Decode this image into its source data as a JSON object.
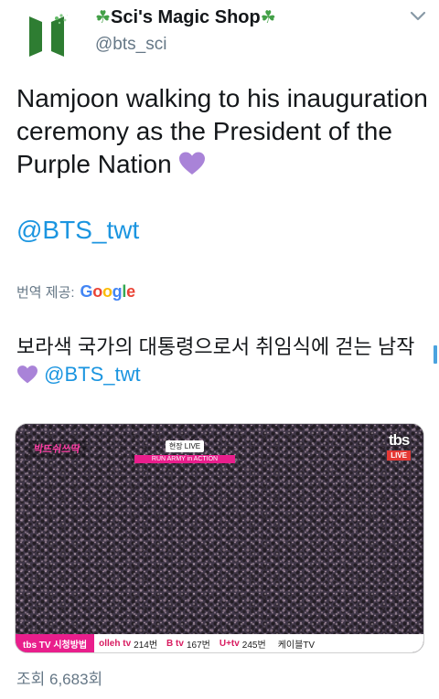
{
  "author": {
    "display_name": "Sci's Magic Shop",
    "clover_emoji": "☘",
    "handle": "@bts_sci",
    "avatar_logo_text": "BTS",
    "avatar_icon": "bts-logo-icon"
  },
  "tweet": {
    "text": "Namjoon walking to his inauguration ceremony as the President of the Purple Nation",
    "heart_icon": "purple-heart-icon",
    "mention": "@BTS_twt"
  },
  "translation": {
    "label": "번역 제공:",
    "provider": "Google",
    "text": "보라색 국가의 대통령으로서 취임식에 걷는 남작",
    "mention": "@BTS_twt"
  },
  "media": {
    "overlay_logo": "박뜨쉬쓰딱",
    "overlay_live_small": "현장 LIVE",
    "overlay_army": "RUN ARMY in ACTION",
    "channel_logo": "tbs",
    "channel_live": "LIVE",
    "ticker": {
      "lead": "tbs TV 시청방법",
      "items": [
        {
          "brand": "olleh tv",
          "channel": "214번"
        },
        {
          "brand": "B tv",
          "channel": "167번"
        },
        {
          "brand": "U+tv",
          "channel": "245번"
        },
        {
          "brand": "",
          "channel": "케이블TV"
        }
      ]
    }
  },
  "views": "조회 6,683회",
  "colors": {
    "link": "#1b95e0",
    "secondary_text": "#657786",
    "heart": "#a983d8",
    "clover": "#43a047"
  }
}
